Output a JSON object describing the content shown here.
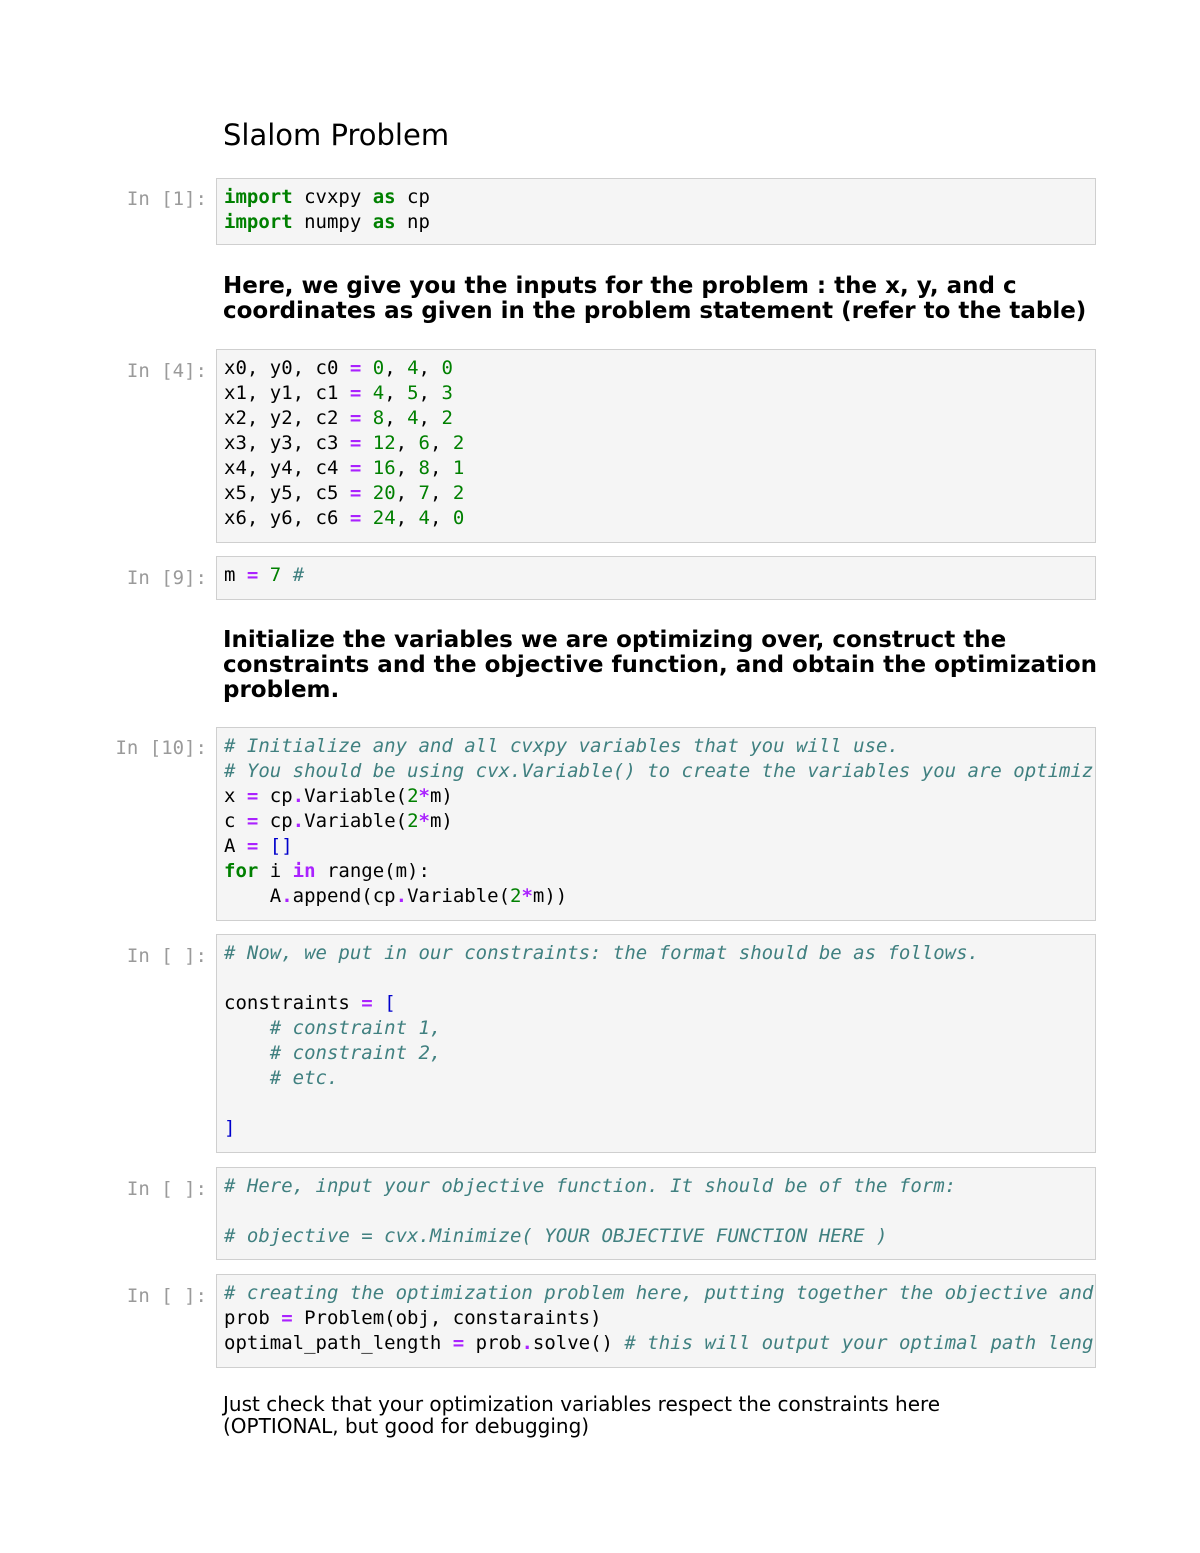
{
  "title": "Slalom Problem",
  "cells": [
    {
      "prompt": "In [1]:",
      "lines": [
        "import cvxpy as cp",
        "import numpy as np"
      ]
    },
    {
      "prompt": "In [4]:",
      "lines": [
        "x0, y0, c0 = 0, 4, 0",
        "x1, y1, c1 = 4, 5, 3",
        "x2, y2, c2 = 8, 4, 2",
        "x3, y3, c3 = 12, 6, 2",
        "x4, y4, c4 = 16, 8, 1",
        "x5, y5, c5 = 20, 7, 2",
        "x6, y6, c6 = 24, 4, 0"
      ]
    },
    {
      "prompt": "In [9]:",
      "lines": [
        "m = 7 #"
      ]
    },
    {
      "prompt": "In [10]:",
      "lines": [
        "# Initialize any and all cvxpy variables that you will use.",
        "# You should be using cvx.Variable() to create the variables you are optimiz",
        "x = cp.Variable(2*m)",
        "c = cp.Variable(2*m)",
        "A = []",
        "for i in range(m):",
        "    A.append(cp.Variable(2*m))"
      ]
    },
    {
      "prompt": "In [ ]:",
      "lines": [
        "# Now, we put in our constraints: the format should be as follows.",
        "",
        "constraints = [",
        "    # constraint 1,",
        "    # constraint 2,",
        "    # etc.",
        "",
        "]"
      ]
    },
    {
      "prompt": "In [ ]:",
      "lines": [
        "# Here, input your objective function. It should be of the form:",
        "",
        "# objective = cvx.Minimize( YOUR OBJECTIVE FUNCTION HERE )"
      ]
    },
    {
      "prompt": "In [ ]:",
      "lines": [
        "# creating the optimization problem here, putting together the objective and",
        "prob = Problem(obj, constaraints)",
        "optimal_path_length = prob.solve() # this will output your optimal path leng"
      ]
    }
  ],
  "markdown": {
    "inputs_line1": "Here, we give you the inputs for the problem : the x, y, and c",
    "inputs_line2": "coordinates as given in the problem statement (refer to the table)",
    "init_line1": "Initialize the variables we are optimizing over, construct the",
    "init_line2": "constraints and the objective function, and obtain the optimization",
    "init_line3": "problem.",
    "check_line1": "Just check that your optimization variables respect the constraints here",
    "check_line2": "(OPTIONAL, but good for debugging)"
  },
  "colors": {
    "keyword": "#008000",
    "operator": "#aa22ff",
    "number": "#008000",
    "comment": "#408080",
    "prompt": "#9a9a9a",
    "cell_bg": "#f5f5f5",
    "cell_border": "#cfcfcf"
  }
}
